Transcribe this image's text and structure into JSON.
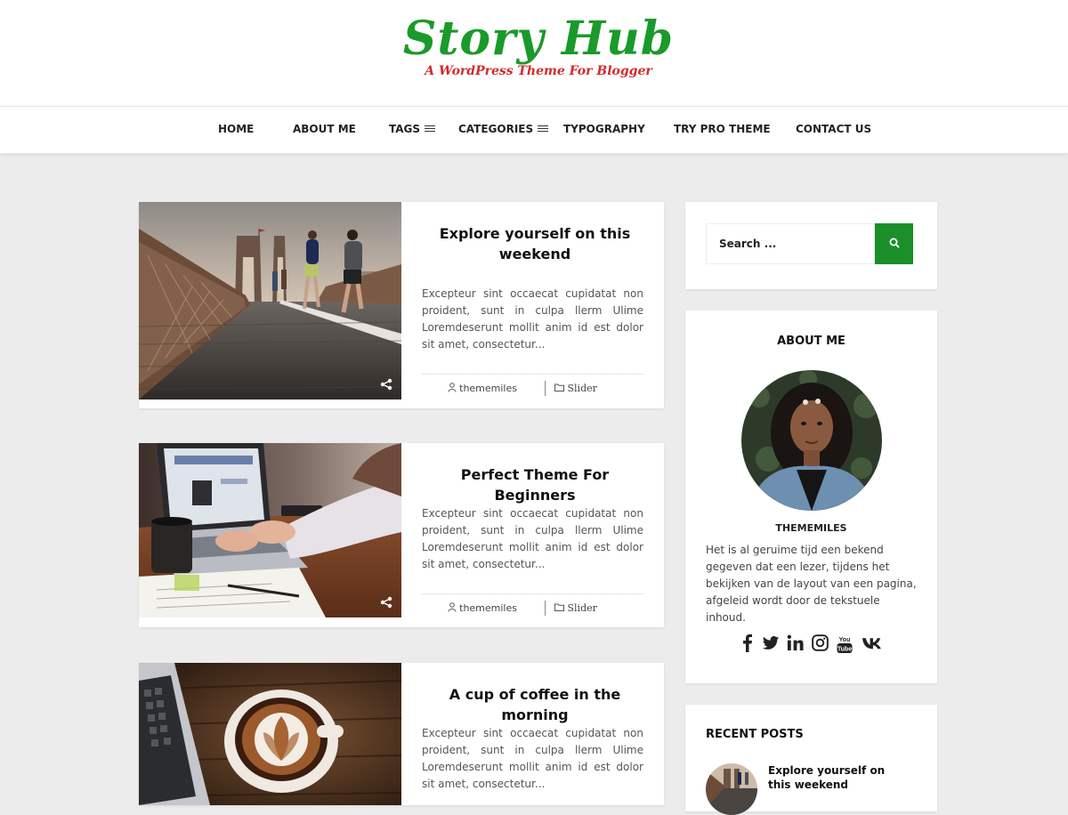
{
  "branding": {
    "title": "Story Hub",
    "tagline": "A WordPress Theme For Blogger",
    "title_color": "#1a9a2a",
    "tagline_color": "#d42a2a"
  },
  "nav": {
    "items": [
      {
        "label": "HOME",
        "has_menu_icon": false
      },
      {
        "label": "ABOUT ME",
        "has_menu_icon": false
      },
      {
        "label": "TAGS",
        "has_menu_icon": true
      },
      {
        "label": "CATEGORIES",
        "has_menu_icon": true
      },
      {
        "label": "TYPOGRAPHY",
        "has_menu_icon": false
      },
      {
        "label": "TRY PRO THEME",
        "has_menu_icon": false
      },
      {
        "label": "CONTACT US",
        "has_menu_icon": false
      }
    ]
  },
  "posts": [
    {
      "title": "Explore yourself on this weekend",
      "excerpt": "Excepteur sint occaecat cupidatat non proident, sunt in culpa llerm Ulime Loremdeserunt mollit anim id est dolor sit amet, consectetur...",
      "author": "thememiles",
      "category": "Slider",
      "image": "photo: runners on a bridge",
      "share_icon": "share-icon"
    },
    {
      "title": "Perfect Theme For Beginners",
      "excerpt": "Excepteur sint occaecat cupidatat non proident, sunt in culpa llerm Ulime Loremdeserunt mollit anim id est dolor sit amet, consectetur...",
      "author": "thememiles",
      "category": "Slider",
      "image": "photo: hands typing on a laptop",
      "share_icon": "share-icon"
    },
    {
      "title": "A cup of coffee in the morning",
      "excerpt": "Excepteur sint occaecat cupidatat non proident, sunt in culpa llerm Ulime Loremdeserunt mollit anim id est dolor sit amet, consectetur...",
      "image": "photo: latte art coffee next to a laptop"
    }
  ],
  "sidebar": {
    "search": {
      "placeholder": "Search ...",
      "button_icon": "search-icon",
      "button_color": "#1a8f2a"
    },
    "about": {
      "title": "ABOUT ME",
      "name": "THEMEMILES",
      "bio": "Het is al geruime tijd een bekend gegeven dat een lezer, tijdens het bekijken van de layout van een pagina, afgeleid wordt door de tekstuele inhoud.",
      "social": [
        "facebook-icon",
        "twitter-icon",
        "linkedin-icon",
        "instagram-icon",
        "youtube-icon",
        "vk-icon"
      ]
    },
    "recent": {
      "title": "RECENT POSTS",
      "items": [
        {
          "title": "Explore yourself on this weekend"
        }
      ]
    }
  }
}
